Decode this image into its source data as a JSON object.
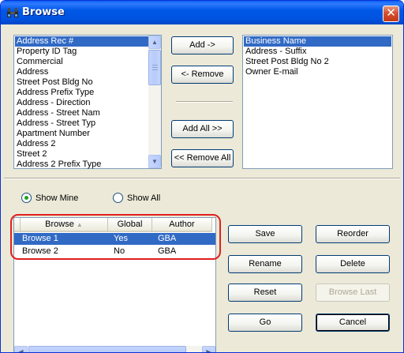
{
  "window": {
    "title": "Browse",
    "close_glyph": "✕"
  },
  "available_fields": [
    "Address Rec #",
    "Property ID Tag",
    "Commercial",
    "Address",
    "Street Post Bldg No",
    "Address Prefix Type",
    "Address - Direction",
    "Address - Street Nam",
    "Address - Street Typ",
    "Apartment Number",
    "Address 2",
    "Street 2",
    "Address 2 Prefix Type"
  ],
  "selected_fields": [
    "Business Name",
    "Address - Suffix",
    "Street Post Bldg No 2",
    "Owner E-mail"
  ],
  "buttons": {
    "add": "Add ->",
    "remove": "<- Remove",
    "add_all": "Add All >>",
    "remove_all": "<< Remove All",
    "save": "Save",
    "reorder": "Reorder",
    "rename": "Rename",
    "delete": "Delete",
    "reset": "Reset",
    "browse_last": "Browse Last",
    "go": "Go",
    "cancel": "Cancel"
  },
  "filter": {
    "show_mine": "Show Mine",
    "show_all": "Show All",
    "selected": "show_mine"
  },
  "browse_table": {
    "columns": [
      "Browse",
      "Global",
      "Author"
    ],
    "sort_indicator": "▲",
    "rows": [
      {
        "browse": "Browse 1",
        "global": "Yes",
        "author": "GBA"
      },
      {
        "browse": "Browse 2",
        "global": "No",
        "author": "GBA"
      }
    ]
  },
  "icons": {
    "app": "binoculars-icon",
    "close": "close-icon",
    "scroll_up": "▲",
    "scroll_down": "▼",
    "scroll_left": "◀",
    "scroll_right": "▶"
  },
  "colors": {
    "selection": "#316ac5",
    "titlebar": "#0058e6",
    "highlight_oval": "#e02020"
  }
}
